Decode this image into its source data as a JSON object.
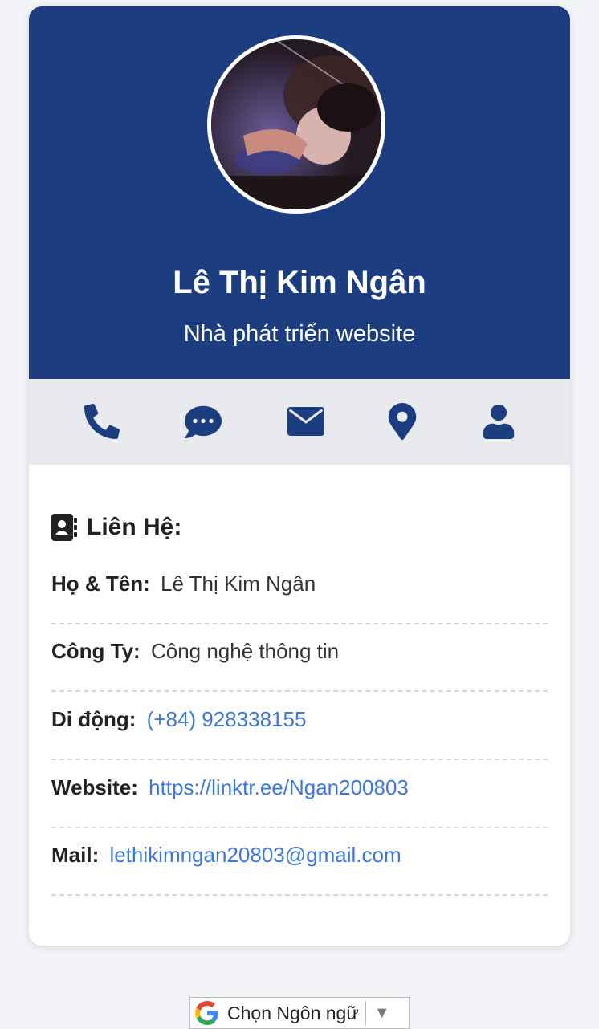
{
  "profile": {
    "name": "Lê Thị Kim Ngân",
    "role": "Nhà phát triển website"
  },
  "icon_bar": [
    {
      "icon": "phone-icon"
    },
    {
      "icon": "chat-icon"
    },
    {
      "icon": "envelope-icon"
    },
    {
      "icon": "map-marker-icon"
    },
    {
      "icon": "user-icon"
    }
  ],
  "contact": {
    "heading": "Liên Hệ:",
    "rows": [
      {
        "label": "Họ & Tên:",
        "value": "Lê Thị Kim Ngân"
      },
      {
        "label": "Công Ty:",
        "value": "Công nghệ thông tin"
      },
      {
        "label": "Di động:",
        "value": "(+84) 928338155"
      },
      {
        "label": "Website:",
        "value": "https://linktr.ee/Ngan200803"
      },
      {
        "label": "Mail:",
        "value": "lethikimngan20803@gmail.com"
      }
    ]
  },
  "language_selector": {
    "label": "Chọn Ngôn ngữ"
  },
  "colors": {
    "header_bg": "#1c3e80",
    "icon_color": "#1c3e80",
    "link_color": "#3b78d8",
    "page_bg": "#f3f4f8",
    "icon_bar_bg": "#e9eaee"
  }
}
